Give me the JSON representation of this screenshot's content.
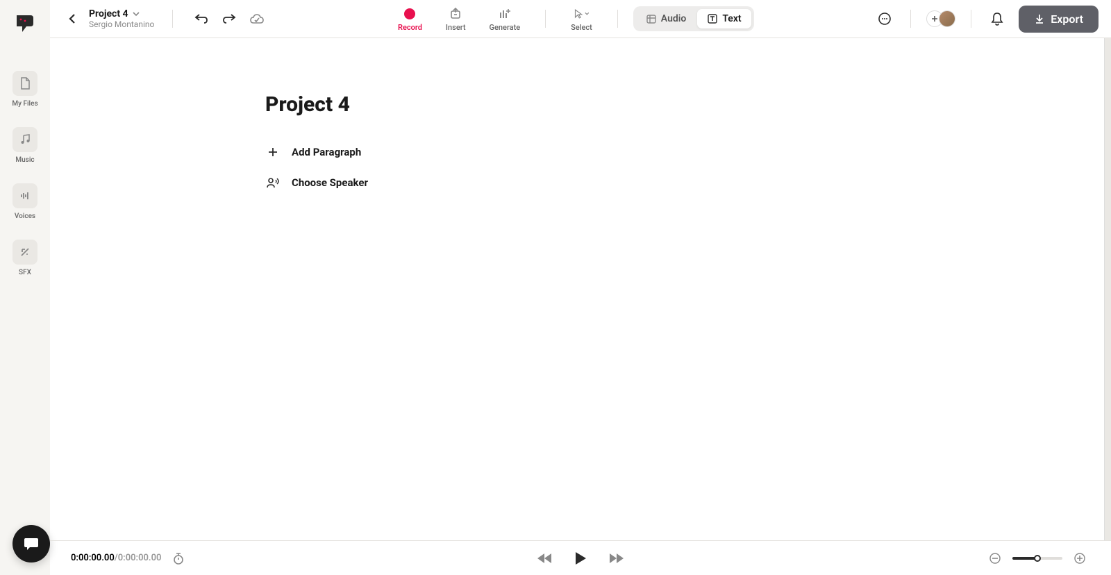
{
  "project": {
    "name": "Project 4",
    "user": "Sergio Montanino"
  },
  "sidebar": {
    "items": [
      {
        "label": "My Files"
      },
      {
        "label": "Music"
      },
      {
        "label": "Voices"
      },
      {
        "label": "SFX"
      }
    ]
  },
  "tools": {
    "record": "Record",
    "insert": "Insert",
    "generate": "Generate",
    "select": "Select"
  },
  "mode": {
    "audio": "Audio",
    "text": "Text"
  },
  "export_label": "Export",
  "page": {
    "title": "Project 4",
    "add_paragraph": "Add Paragraph",
    "choose_speaker": "Choose Speaker"
  },
  "playback": {
    "current": "0:00:00.00",
    "separator": " / ",
    "total": "0:00:00.00"
  }
}
